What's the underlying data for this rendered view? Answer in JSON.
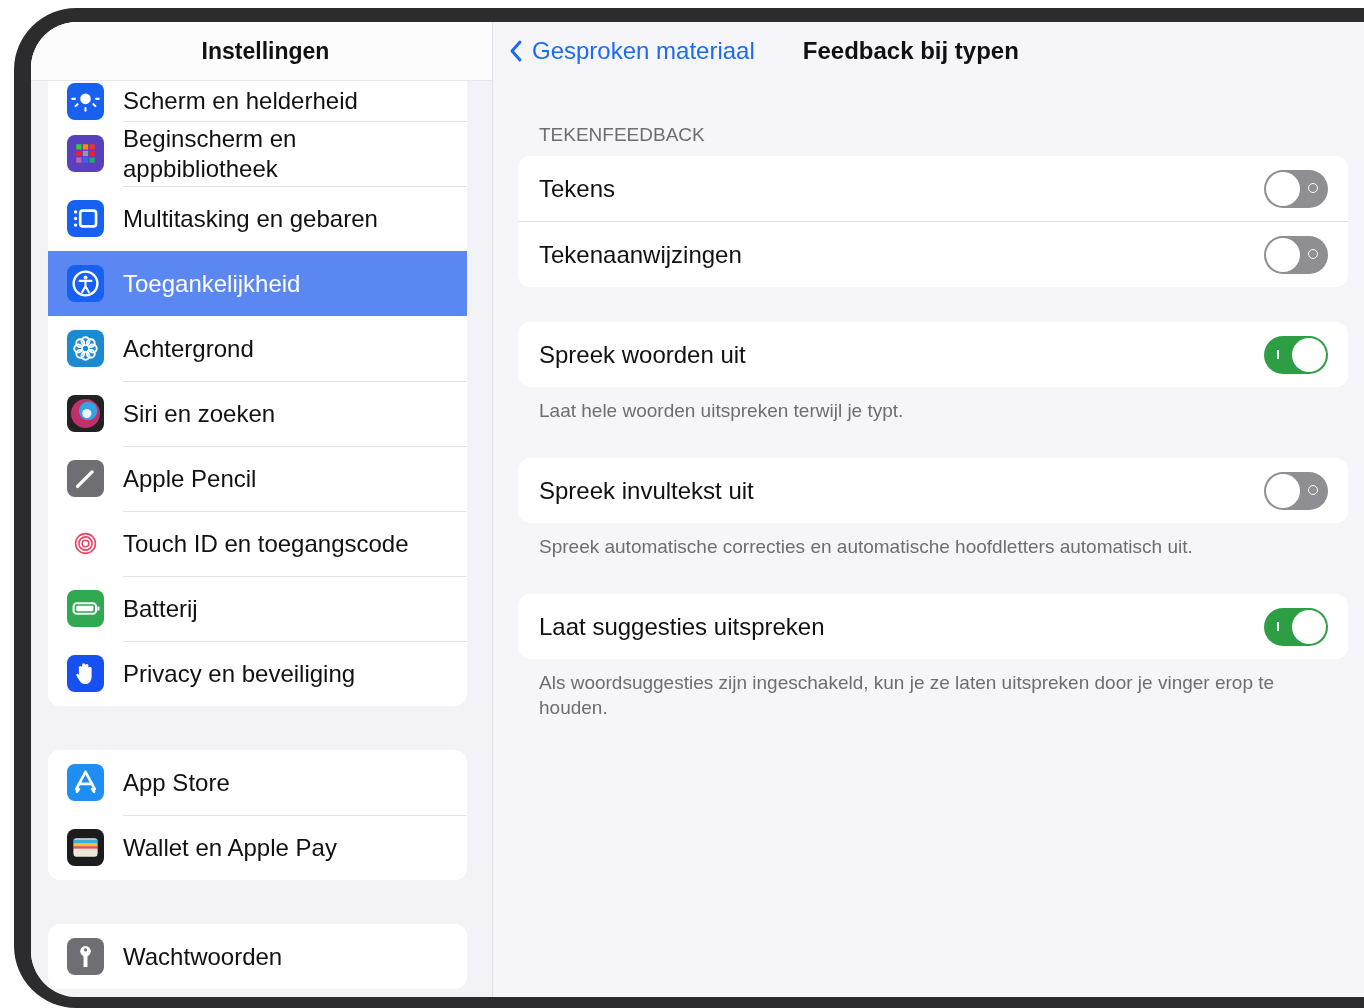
{
  "sidebar": {
    "title": "Instellingen",
    "groups": [
      {
        "items": [
          {
            "label": "Scherm en helderheid",
            "selected": false
          },
          {
            "label": "Beginscherm en appbibliotheek",
            "selected": false
          },
          {
            "label": "Multitasking en gebaren",
            "selected": false
          },
          {
            "label": "Toegankelijkheid",
            "selected": true
          },
          {
            "label": "Achtergrond",
            "selected": false
          },
          {
            "label": "Siri en zoeken",
            "selected": false
          },
          {
            "label": "Apple Pencil",
            "selected": false
          },
          {
            "label": "Touch ID en toegangscode",
            "selected": false
          },
          {
            "label": "Batterij",
            "selected": false
          },
          {
            "label": "Privacy en beveiliging",
            "selected": false
          }
        ]
      },
      {
        "items": [
          {
            "label": "App Store",
            "selected": false
          },
          {
            "label": "Wallet en Apple Pay",
            "selected": false
          }
        ]
      },
      {
        "items": [
          {
            "label": "Wachtwoorden",
            "selected": false
          }
        ]
      }
    ]
  },
  "detail": {
    "back": "Gesproken materiaal",
    "title": "Feedback bij typen",
    "sections": [
      {
        "header": "TEKENFEEDBACK",
        "rows": [
          {
            "label": "Tekens",
            "on": false
          },
          {
            "label": "Tekenaanwijzingen",
            "on": false
          }
        ]
      },
      {
        "rows": [
          {
            "label": "Spreek woorden uit",
            "on": true
          }
        ],
        "footer": "Laat hele woorden uitspreken terwijl je typt."
      },
      {
        "rows": [
          {
            "label": "Spreek invultekst uit",
            "on": false
          }
        ],
        "footer": "Spreek automatische correcties en automatische hoofdletters automatisch uit."
      },
      {
        "rows": [
          {
            "label": "Laat suggesties uitspreken",
            "on": true
          }
        ],
        "footer": "Als woordsuggesties zijn ingeschakeld, kun je ze laten uitspreken door je vinger erop te houden."
      }
    ]
  }
}
